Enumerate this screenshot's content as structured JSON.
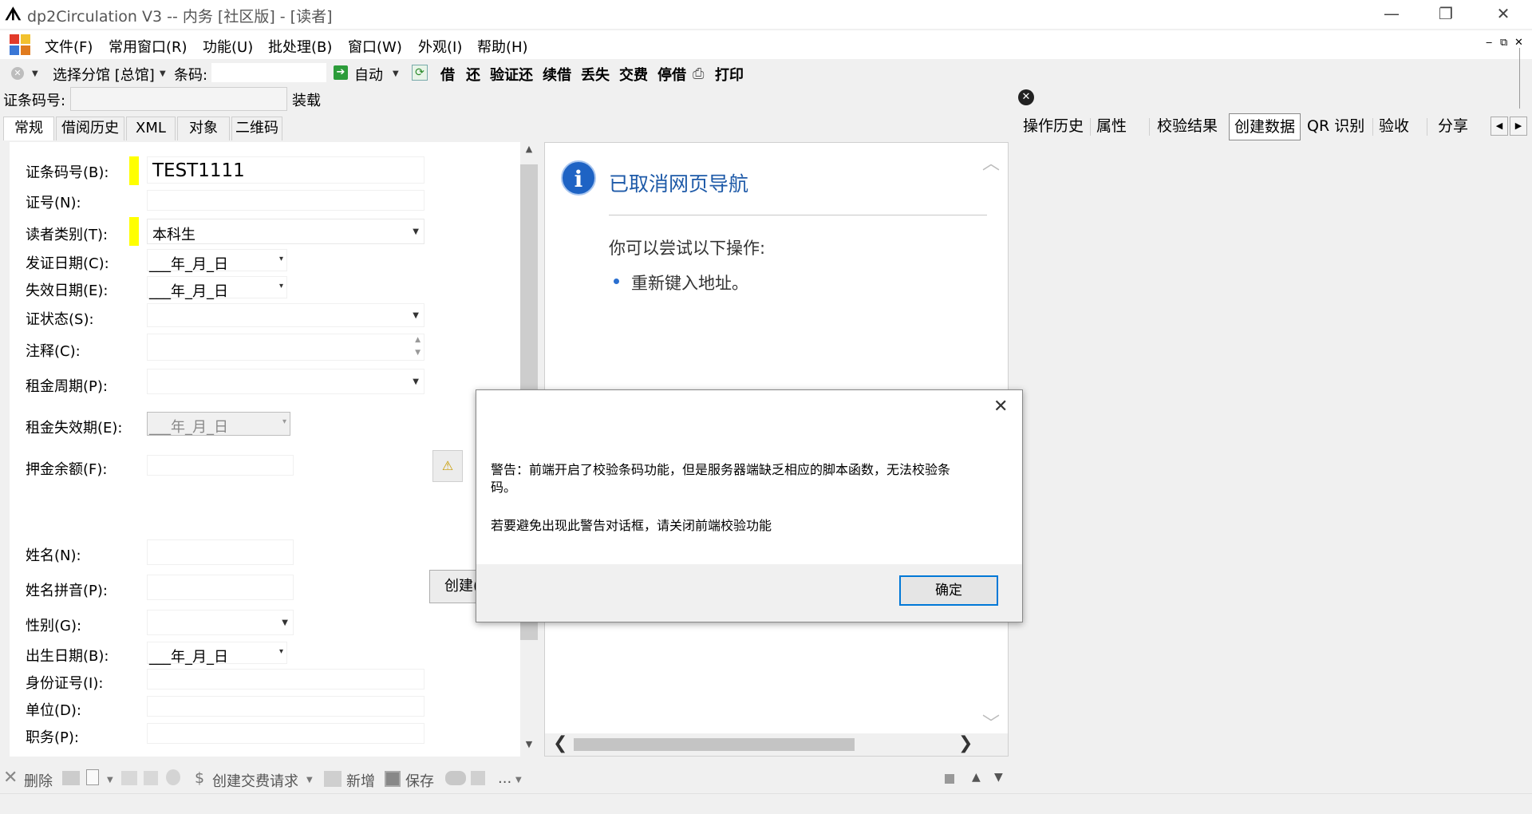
{
  "window": {
    "title": "dp2Circulation V3 -- 内务 [社区版] - [读者]",
    "minimize": "—",
    "restore": "❐",
    "close": "✕"
  },
  "menu": [
    "文件(F)",
    "常用窗口(R)",
    "功能(U)",
    "批处理(B)",
    "窗口(W)",
    "外观(I)",
    "帮助(H)"
  ],
  "mdi_controls": [
    "‒",
    "⧉",
    "✕"
  ],
  "toolbar": {
    "library_label": "选择分馆 [总馆]",
    "barcode_label": "条码:",
    "mode_label": "自动",
    "actions": [
      "借",
      "还",
      "验证还",
      "续借",
      "丢失",
      "交费",
      "停借",
      "打印"
    ]
  },
  "load_row": {
    "label": "证条码号:",
    "load_button": "装载"
  },
  "tabs": [
    "常规",
    "借阅历史",
    "XML",
    "对象",
    "二维码"
  ],
  "form": {
    "barcode_label": "证条码号(B):",
    "barcode_value": "TEST1111",
    "card_no_label": "证号(N):",
    "reader_type_label": "读者类别(T):",
    "reader_type_value": "本科生",
    "issue_date_label": "发证日期(C):",
    "expire_date_label": "失效日期(E):",
    "date_placeholder": "___年_月_日",
    "state_label": "证状态(S):",
    "comment_label": "注释(C):",
    "rent_period_label": "租金周期(P):",
    "rent_expire_label": "租金失效期(E):",
    "deposit_label": "押金余额(F):",
    "name_label": "姓名(N):",
    "pinyin_label": "姓名拼音(P):",
    "create_button": "创建(",
    "gender_label": "性别(G):",
    "birth_label": "出生日期(B):",
    "id_card_label": "身份证号(I):",
    "unit_label": "单位(D):",
    "post_label": "职务(P):"
  },
  "browser": {
    "heading": "已取消网页导航",
    "subheading": "你可以尝试以下操作:",
    "bullet": "重新键入地址。",
    "info_icon": "i"
  },
  "right_tabs": [
    "操作历史",
    "属性",
    "校验结果",
    "创建数据",
    "QR 识别",
    "验收",
    "分享"
  ],
  "dialog": {
    "message_line1": "警告：前端开启了校验条码功能，但是服务器端缺乏相应的脚本函数，无法校验条",
    "message_line2": "码。",
    "message_line3": "若要避免出现此警告对话框，请关闭前端校验功能",
    "ok_button": "确定"
  },
  "bottom_toolbar": {
    "delete": "删除",
    "fee_request": "创建交费请求",
    "add": "新增",
    "save": "保存",
    "more": "..."
  },
  "colors": {
    "highlight": "#ffff00",
    "link_blue": "#1e5aa8",
    "dialog_accent": "#0078d7"
  }
}
